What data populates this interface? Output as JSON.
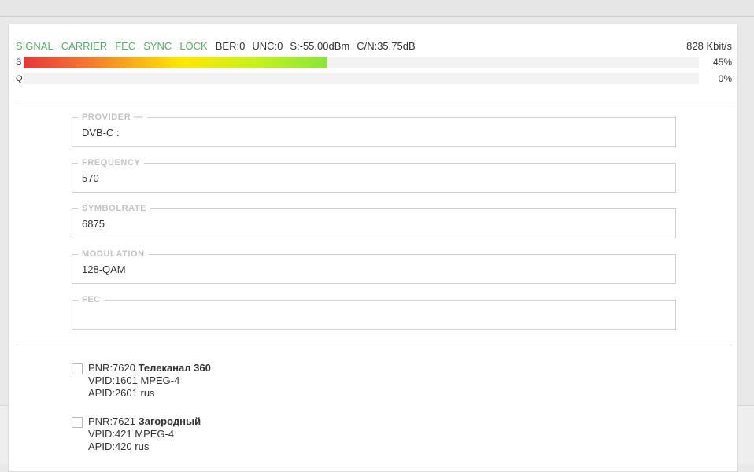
{
  "status": {
    "flags": [
      "SIGNAL",
      "CARRIER",
      "FEC",
      "SYNC",
      "LOCK"
    ],
    "ber": "BER:0",
    "unc": "UNC:0",
    "signal_level": "S:-55.00dBm",
    "cn": "C/N:35.75dB",
    "bitrate": "828 Kbit/s",
    "flag_color": "#5cad6a"
  },
  "meters": {
    "s": {
      "label": "S",
      "percent_text": "45%",
      "value": 45
    },
    "q": {
      "label": "Q",
      "percent_text": "0%",
      "value": 0
    }
  },
  "fields": {
    "provider": {
      "legend": "PROVIDER —",
      "value": "DVB-C :"
    },
    "frequency": {
      "legend": "FREQUENCY",
      "value": "570"
    },
    "symbolrate": {
      "legend": "SYMBOLRATE",
      "value": "6875"
    },
    "modulation": {
      "legend": "MODULATION",
      "value": "128-QAM"
    },
    "fec": {
      "legend": "FEC",
      "value": ""
    }
  },
  "channels": [
    {
      "pnr": "PNR:7620",
      "name": "Телеканал 360",
      "vpid": "VPID:1601 MPEG-4",
      "apid": "APID:2601 rus"
    },
    {
      "pnr": "PNR:7621",
      "name": "Загородный",
      "vpid": "VPID:421 MPEG-4",
      "apid": "APID:420 rus"
    }
  ]
}
